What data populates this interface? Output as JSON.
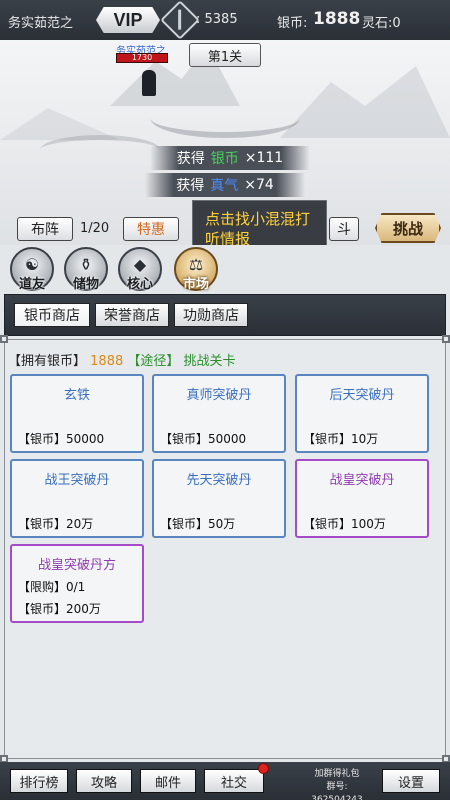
{
  "topbar": {
    "player_name": "务实茹范之",
    "vip_label": "VIP",
    "power": ": 5385",
    "silver_label": "银币:",
    "silver_value": "1888",
    "spirit_stone": "灵石:0"
  },
  "scene": {
    "char_name": "务实茹范之",
    "hp": "1730",
    "level_label": "第1关",
    "gains": [
      {
        "prefix": "获得",
        "item": "银币",
        "qty": "×111",
        "color": "#46d25a"
      },
      {
        "prefix": "获得",
        "item": "真气",
        "qty": "×74",
        "color": "#4d8cff"
      }
    ],
    "formation_label": "布阵",
    "formation_count": "1/20",
    "special_label": "特惠",
    "partial_label": "斗",
    "challenge_label": "挑战",
    "tip_text": "点击找小混混打听情报"
  },
  "nav": [
    {
      "label": "道友",
      "glyph": "☯",
      "active": false
    },
    {
      "label": "储物",
      "glyph": "⚱",
      "active": false
    },
    {
      "label": "核心",
      "glyph": "◆",
      "active": false
    },
    {
      "label": "市场",
      "glyph": "⚖",
      "active": true
    }
  ],
  "shop": {
    "tabs": [
      "银币商店",
      "荣誉商店",
      "功勋商店"
    ],
    "info": {
      "owned_label": "【拥有银币】",
      "owned_value": "1888",
      "route_label": "【途径】",
      "route_value": "挑战关卡"
    },
    "items": [
      {
        "name": "玄铁",
        "price": "【银币】50000",
        "limit": "",
        "color": "blue"
      },
      {
        "name": "真师突破丹",
        "price": "【银币】50000",
        "limit": "",
        "color": "blue"
      },
      {
        "name": "后天突破丹",
        "price": "【银币】10万",
        "limit": "",
        "color": "blue"
      },
      {
        "name": "战王突破丹",
        "price": "【银币】20万",
        "limit": "",
        "color": "blue"
      },
      {
        "name": "先天突破丹",
        "price": "【银币】50万",
        "limit": "",
        "color": "blue"
      },
      {
        "name": "战皇突破丹",
        "price": "【银币】100万",
        "limit": "",
        "color": "purple"
      },
      {
        "name": "战皇突破丹方",
        "price": "【银币】200万",
        "limit": "【限购】0/1",
        "color": "purple"
      }
    ]
  },
  "bottom": {
    "ranking": "排行榜",
    "guide": "攻略",
    "mail": "邮件",
    "social": "社交",
    "group_line1": "加群得礼包",
    "group_line2": "群号: 362504243",
    "settings": "设置"
  },
  "colors": {
    "bar_dark": "#2a2f36",
    "blue_border": "#5a86c0",
    "purple_border": "#a54bc7",
    "tip_text": "#ffd23a",
    "red_dot": "#e0231f"
  }
}
